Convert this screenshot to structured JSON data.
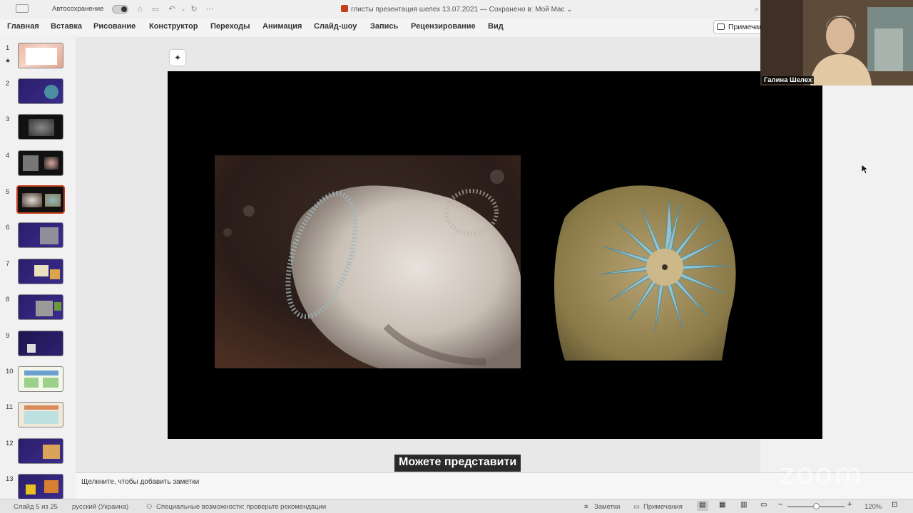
{
  "titlebar": {
    "autosave_label": "Автосохранение",
    "document_title": "глисты презентация шелех 13.07.2021 — Сохранено в: Мой Mac"
  },
  "menubar": {
    "items": [
      "Главная",
      "Вставка",
      "Рисование",
      "Конструктор",
      "Переходы",
      "Анимация",
      "Слайд-шоу",
      "Запись",
      "Рецензирование",
      "Вид"
    ],
    "comments_button": "Примечания"
  },
  "thumbnails": {
    "numbers": [
      "1",
      "2",
      "3",
      "4",
      "5",
      "6",
      "7",
      "8",
      "9",
      "10",
      "11",
      "12",
      "13"
    ],
    "selected": 5
  },
  "notes": {
    "placeholder": "Щелкните, чтобы добавить заметки"
  },
  "caption": {
    "text": "Можете представити"
  },
  "video": {
    "participant_name": "Галина Шелех"
  },
  "watermark": "zoom",
  "statusbar": {
    "slide_counter": "Слайд 5 из 25",
    "language": "русский (Украина)",
    "accessibility": "Специальные возможности: проверьте рекомендации",
    "notes_label": "Заметки",
    "comments_label": "Примечания",
    "zoom_level": "120%"
  },
  "colors": {
    "accent": "#c43e1c",
    "slide_bg": "#000000",
    "chrome_bg": "#f1f1f1"
  }
}
